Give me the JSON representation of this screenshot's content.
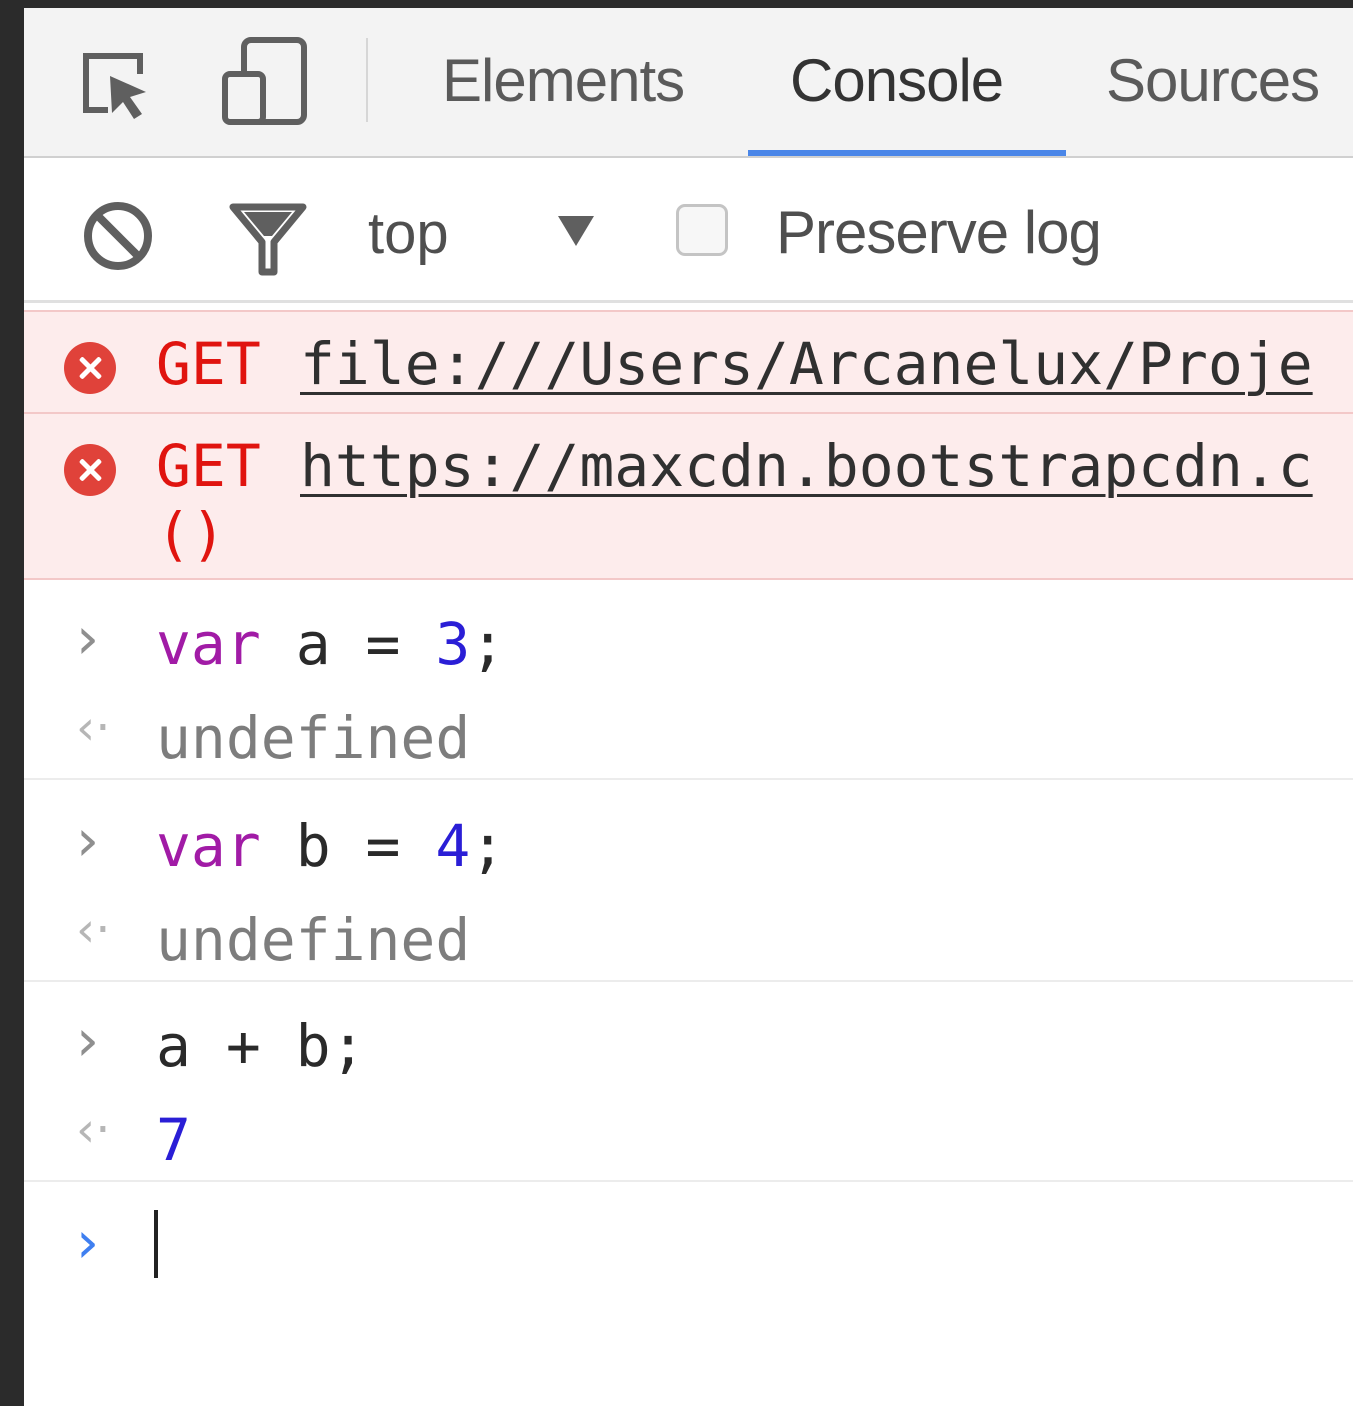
{
  "tabs": [
    {
      "label": "Elements"
    },
    {
      "label": "Console",
      "active": true
    },
    {
      "label": "Sources"
    }
  ],
  "toolbar": {
    "context": "top",
    "preserve_log_label": "Preserve log",
    "preserve_log_checked": false
  },
  "errors": [
    {
      "method": "GET",
      "url": "file:///Users/Arcanelux/Proje",
      "continuation": ""
    },
    {
      "method": "GET",
      "url": "https://maxcdn.bootstrapcdn.c",
      "continuation": "()"
    }
  ],
  "entries": [
    {
      "keyword": "var",
      "name": "a",
      "op": "=",
      "value": "3",
      "end": ";",
      "result": "undefined"
    },
    {
      "keyword": "var",
      "name": "b",
      "op": "=",
      "value": "4",
      "end": ";",
      "result": "undefined"
    },
    {
      "expression": "a + b;",
      "result": "7"
    }
  ],
  "colors": {
    "active_tab_underline": "#4a86e8",
    "error_background": "#fdecec",
    "error_text": "#e0140f",
    "keyword": "#a11ba6",
    "number": "#2a1ed6",
    "active_prompt": "#3f7ff0"
  },
  "icons": [
    "inspect-element-icon",
    "device-toolbar-icon",
    "clear-console-icon",
    "filter-icon",
    "dropdown-arrow-icon",
    "error-icon",
    "input-prompt-icon",
    "output-prompt-icon"
  ]
}
